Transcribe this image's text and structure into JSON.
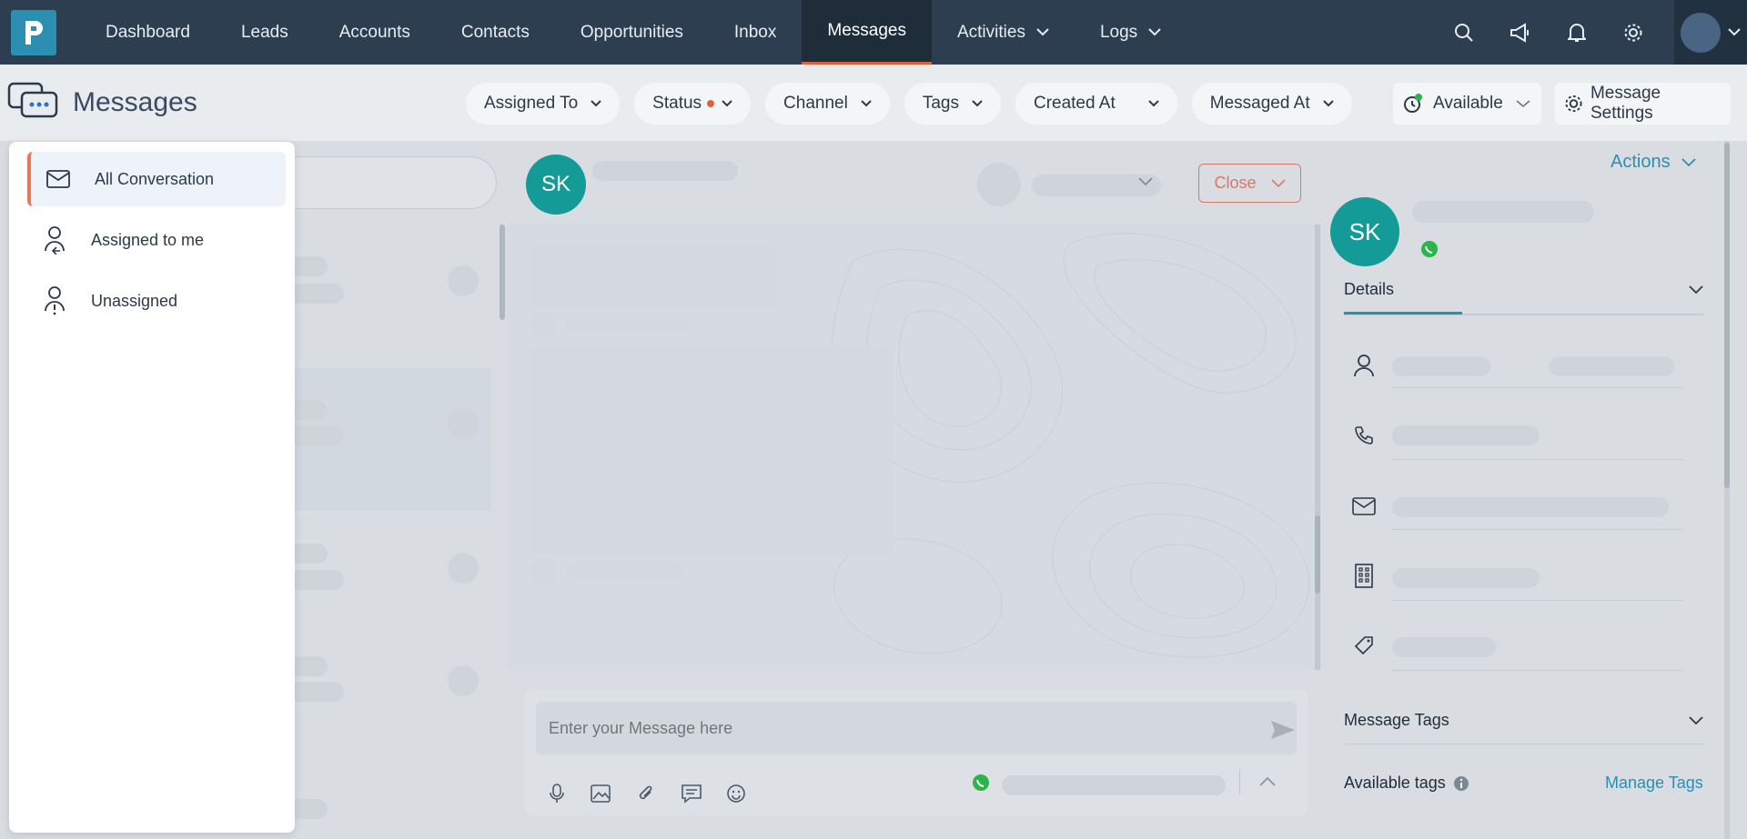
{
  "nav": {
    "items": [
      {
        "label": "Dashboard"
      },
      {
        "label": "Leads"
      },
      {
        "label": "Accounts"
      },
      {
        "label": "Contacts"
      },
      {
        "label": "Opportunities"
      },
      {
        "label": "Inbox"
      },
      {
        "label": "Messages",
        "active": true
      },
      {
        "label": "Activities",
        "has_dropdown": true
      },
      {
        "label": "Logs",
        "has_dropdown": true
      }
    ],
    "icons": [
      "search-icon",
      "megaphone-icon",
      "bell-icon",
      "gear-icon"
    ]
  },
  "header": {
    "title": "Messages",
    "filters": [
      "Assigned To",
      "Status",
      "Channel",
      "Tags",
      "Created At",
      "Messaged At"
    ],
    "availability": "Available",
    "settings_label": "Message Settings"
  },
  "dropdown": {
    "items": [
      {
        "label": "All Conversation",
        "icon": "mail-icon",
        "active": true
      },
      {
        "label": "Assigned to me",
        "icon": "user-assigned-icon"
      },
      {
        "label": "Unassigned",
        "icon": "user-unassigned-icon"
      }
    ]
  },
  "chat": {
    "contact_initials": "SK",
    "close_label": "Close",
    "composer_placeholder": "Enter your Message here"
  },
  "details": {
    "actions_label": "Actions",
    "initials": "SK",
    "details_tab": "Details",
    "message_tags_label": "Message Tags",
    "available_tags_label": "Available tags",
    "manage_tags_label": "Manage Tags"
  },
  "colors": {
    "nav_bg": "#2d3e50",
    "accent": "#e0623a",
    "brand": "#2a8fb0",
    "avatar": "#149b98"
  }
}
